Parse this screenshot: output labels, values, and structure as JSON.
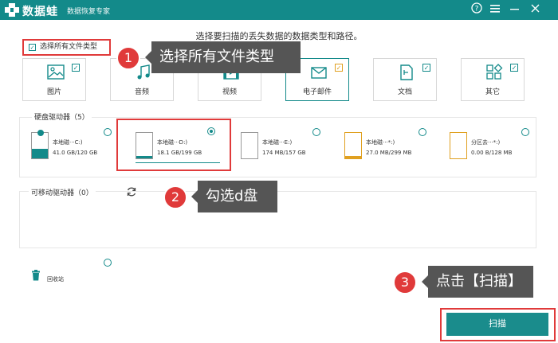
{
  "titlebar": {
    "app_name": "数据蛙",
    "subtitle": "数据恢复专家",
    "help_icon": "help-icon",
    "menu_icon": "menu-icon",
    "min_icon": "minimize-icon",
    "close_icon": "close-icon"
  },
  "instruction": "选择要扫描的丢失数据的数据类型和路径。",
  "select_all": {
    "label": "选择所有文件类型",
    "checked": true
  },
  "types": [
    {
      "label": "图片",
      "checked": true,
      "icon": "image-icon"
    },
    {
      "label": "音频",
      "checked": true,
      "icon": "audio-icon"
    },
    {
      "label": "视频",
      "checked": true,
      "icon": "video-icon"
    },
    {
      "label": "电子邮件",
      "checked": true,
      "icon": "email-icon"
    },
    {
      "label": "文档",
      "checked": true,
      "icon": "document-icon"
    },
    {
      "label": "其它",
      "checked": true,
      "icon": "other-icon"
    }
  ],
  "hard_drives": {
    "title": "硬盘驱动器（5）",
    "drives": [
      {
        "name": "本地磁···C:)",
        "size": "41.0 GB/120 GB",
        "selected": false,
        "fill": 0.34
      },
      {
        "name": "本地磁···D:)",
        "size": "18.1 GB/199 GB",
        "selected": true,
        "fill": 0.09
      },
      {
        "name": "本地磁···E:)",
        "size": "174 MB/157 GB",
        "selected": false,
        "fill": 0.0
      },
      {
        "name": "本地磁···*:)",
        "size": "27.0 MB/299 MB",
        "selected": false,
        "fill": 0.09
      },
      {
        "name": "分区去···*:)",
        "size": "0.00  B/128 MB",
        "selected": false,
        "fill": 0.0
      }
    ]
  },
  "removable": {
    "title": "可移动驱动器（0）",
    "refresh_icon": "refresh-icon"
  },
  "recycle": {
    "label": "回收站",
    "icon": "trash-icon"
  },
  "scan_button": "扫描",
  "tips": [
    {
      "num": "1",
      "text": "选择所有文件类型"
    },
    {
      "num": "2",
      "text": "勾选d盘"
    },
    {
      "num": "3",
      "text": "点击【扫描】"
    }
  ],
  "colors": {
    "accent": "#138a8a",
    "highlight": "#e03a3a",
    "tip_bg": "#555555"
  }
}
